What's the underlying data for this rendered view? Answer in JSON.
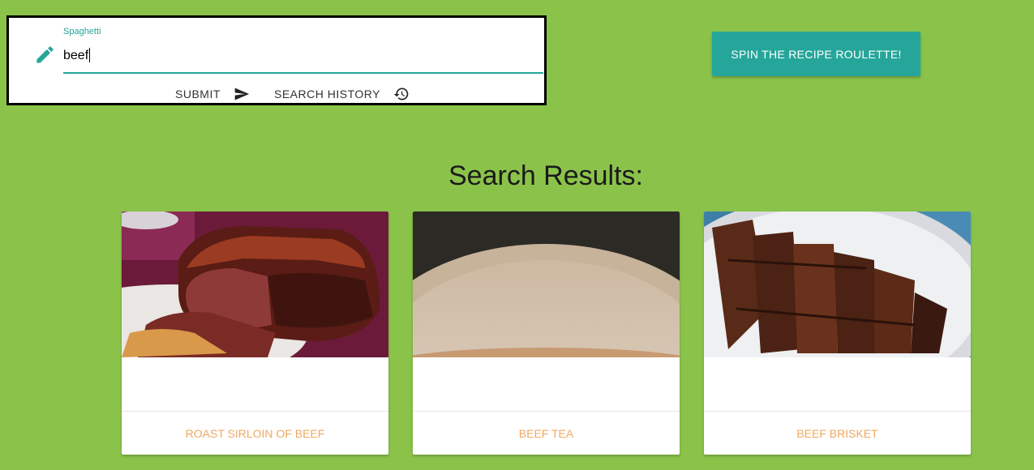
{
  "search": {
    "label": "Spaghetti",
    "value": "beef",
    "submit_label": "Submit",
    "history_label": "Search History",
    "icons": {
      "field": "pencil-icon",
      "submit": "send-icon",
      "history": "history-icon"
    }
  },
  "roulette": {
    "label": "Spin the Recipe Roulette!"
  },
  "results": {
    "title": "Search Results:",
    "cards": [
      {
        "name": "Roast Sirloin of Beef",
        "image": "roast-sirloin-image"
      },
      {
        "name": "Beef Tea",
        "image": "beef-tea-image"
      },
      {
        "name": "Beef Brisket",
        "image": "beef-brisket-image"
      }
    ]
  },
  "colors": {
    "background": "#8bc34a",
    "accent": "#26a69a",
    "card_link": "#f0a860",
    "panel_border": "#000000"
  }
}
